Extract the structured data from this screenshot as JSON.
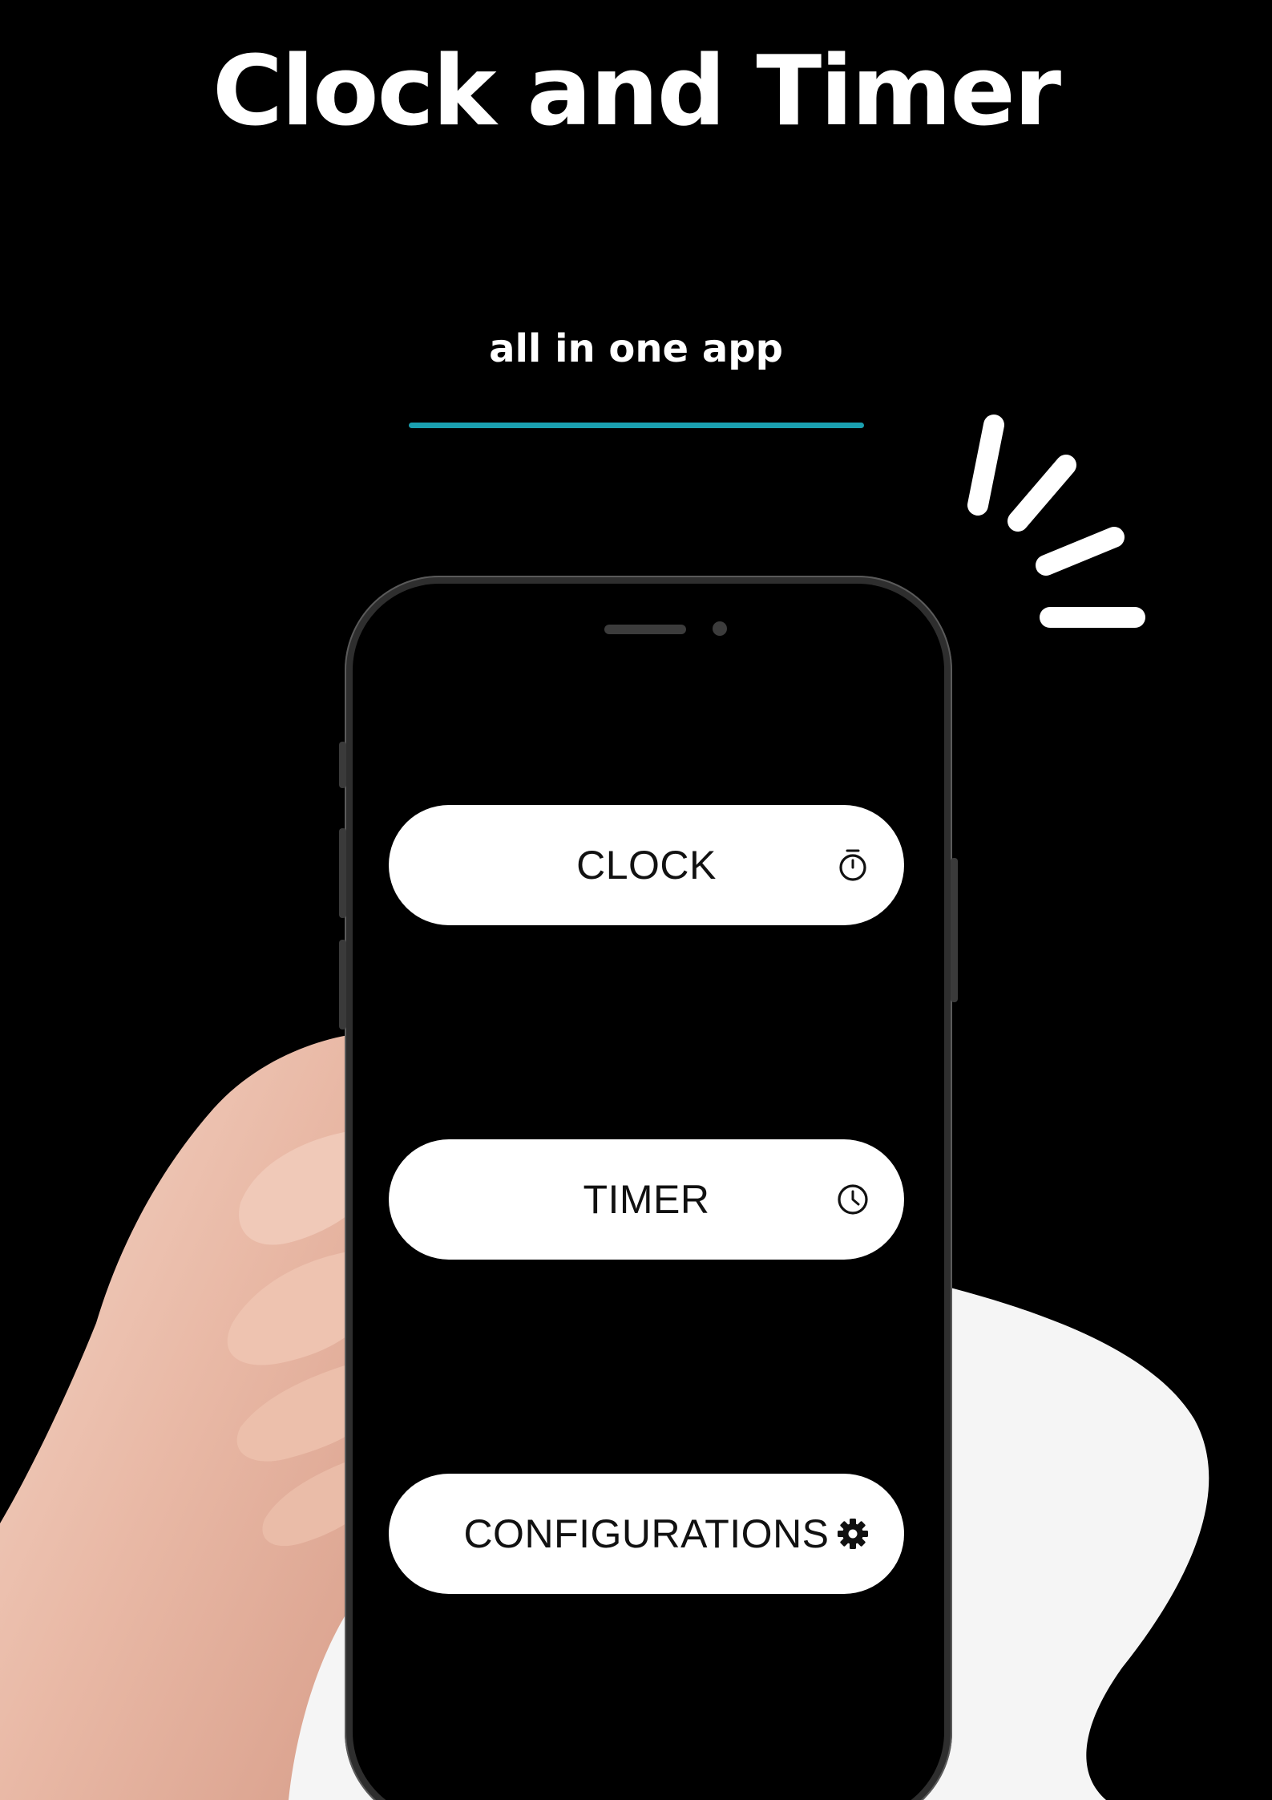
{
  "header": {
    "title": "Clock and Timer",
    "subtitle": "all in one app"
  },
  "colors": {
    "background": "#000000",
    "accent_line": "#1aa0b0",
    "button_bg": "#ffffff",
    "blob": "#f5f5f5"
  },
  "menu": {
    "items": [
      {
        "label": "CLOCK",
        "icon": "stopwatch-icon"
      },
      {
        "label": "TIMER",
        "icon": "clock-icon"
      },
      {
        "label": "CONFIGURATIONS",
        "icon": "gear-icon"
      }
    ]
  }
}
